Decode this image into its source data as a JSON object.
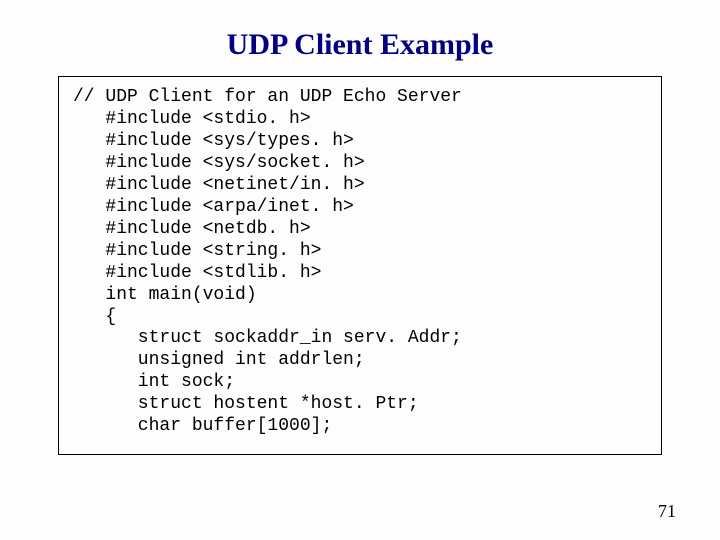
{
  "title": "UDP Client Example",
  "page_number": "71",
  "code": {
    "l0": "// UDP Client for an UDP Echo Server",
    "l1": "   #include <stdio. h>",
    "l2": "   #include <sys/types. h>",
    "l3": "   #include <sys/socket. h>",
    "l4": "   #include <netinet/in. h>",
    "l5": "   #include <arpa/inet. h>",
    "l6": "   #include <netdb. h>",
    "l7": "   #include <string. h>",
    "l8": "   #include <stdlib. h>",
    "l9": "",
    "l10": "   int main(void)",
    "l11": "   {",
    "l12": "      struct sockaddr_in serv. Addr;",
    "l13": "      unsigned int addrlen;",
    "l14": "      int sock;",
    "l15": "      struct hostent *host. Ptr;",
    "l16": "      char buffer[1000];"
  }
}
